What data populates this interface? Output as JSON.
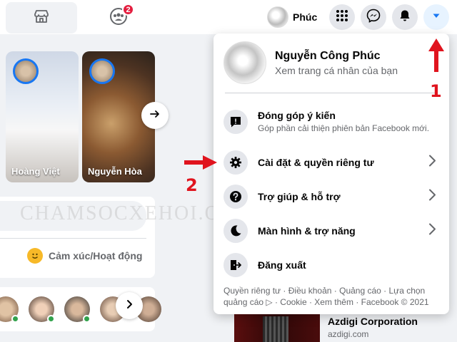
{
  "topbar": {
    "groups_badge": "2",
    "profile_name": "Phúc",
    "icons": [
      "marketplace-icon",
      "groups-icon",
      "grid-menu-icon",
      "messenger-icon",
      "notifications-icon",
      "account-caret-icon"
    ]
  },
  "stories": [
    {
      "name": "Hoàng Việt"
    },
    {
      "name": "Nguyễn Hòa"
    }
  ],
  "composer": {
    "feeling_label": "Cảm xúc/Hoạt động"
  },
  "sponsored": {
    "name": "Azdigi Corporation",
    "url": "azdigi.com"
  },
  "menu": {
    "profile": {
      "name": "Nguyễn Công Phúc",
      "subtitle": "Xem trang cá nhân của bạn"
    },
    "feedback": {
      "label": "Đóng góp ý kiến",
      "sub": "Góp phần cải thiện phiên bản Facebook mới."
    },
    "items": [
      {
        "label": "Cài đặt & quyền riêng tư",
        "has_chevron": true
      },
      {
        "label": "Trợ giúp & hỗ trợ",
        "has_chevron": true
      },
      {
        "label": "Màn hình & trợ năng",
        "has_chevron": true
      },
      {
        "label": "Đăng xuất",
        "has_chevron": false
      }
    ],
    "footer": "Quyền riêng tư · Điều khoản · Quảng cáo · Lựa chọn quảng cáo ▷ · Cookie · Xem thêm · Facebook © 2021"
  },
  "annotations": {
    "step1": "1",
    "step2": "2",
    "watermark": "CHAMSOCXEHOI.ORG",
    "arrow_color": "#e0141e"
  },
  "colors": {
    "brand_blue": "#1877f2",
    "badge_red": "#e41e3f",
    "online_green": "#31a24c"
  }
}
